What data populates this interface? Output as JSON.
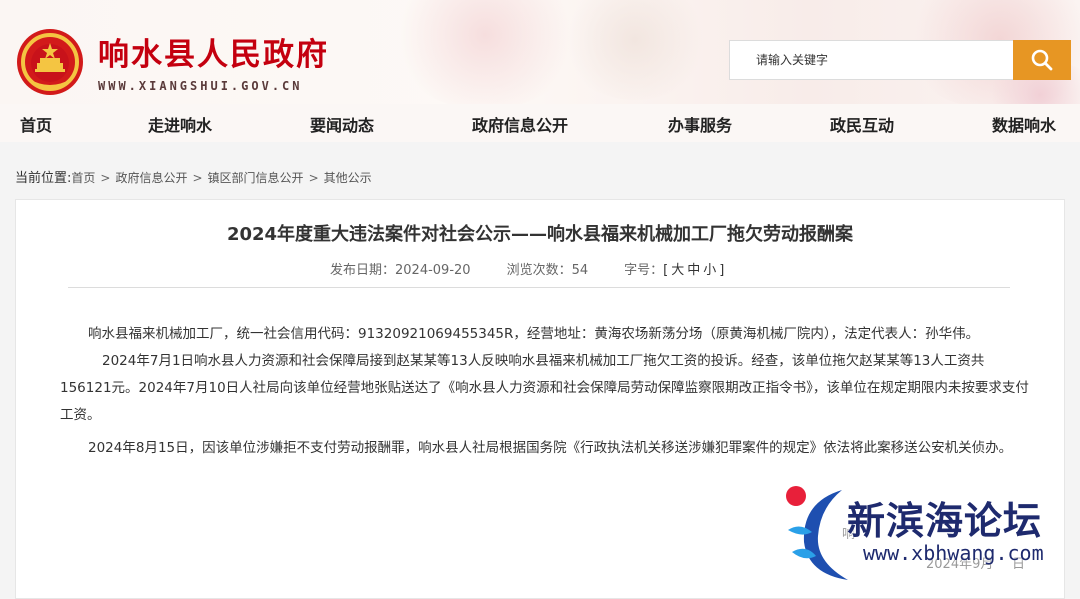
{
  "header": {
    "site_title": "响水县人民政府",
    "site_domain": "WWW.XIANGSHUI.GOV.CN",
    "search_placeholder": "请输入关键字"
  },
  "nav": {
    "items": [
      {
        "label": "首页"
      },
      {
        "label": "走进响水"
      },
      {
        "label": "要闻动态"
      },
      {
        "label": "政府信息公开"
      },
      {
        "label": "办事服务"
      },
      {
        "label": "政民互动"
      },
      {
        "label": "数据响水"
      }
    ]
  },
  "breadcrumb": {
    "lead": "当前位置:",
    "items": [
      "首页",
      "政府信息公开",
      "镇区部门信息公开",
      "其他公示"
    ],
    "separator": ">"
  },
  "article": {
    "title": "2024年度重大违法案件对社会公示——响水县福来机械加工厂拖欠劳动报酬案",
    "date_label": "发布日期：",
    "date": "2024-09-20",
    "views_label": "浏览次数：",
    "views": "54",
    "font_label": "字号：",
    "font_open": "[",
    "font_sizes": [
      "大",
      "中",
      "小"
    ],
    "font_close": "]",
    "paragraphs": [
      "响水县福来机械加工厂，统一社会信用代码：91320921069455345R，经营地址：黄海农场新荡分场（原黄海机械厂院内），法定代表人：孙华伟。",
      "2024年7月1日响水县人力资源和社会保障局接到赵某某等13人反映响水县福来机械加工厂拖欠工资的投诉。经查，该单位拖欠赵某某等13人工资共156121元。2024年7月10日人社局向该单位经营地张贴送达了《响水县人力资源和社会保障局劳动保障监察限期改正指令书》，该单位在规定期限内未按要求支付工资。",
      "2024年8月15日，因该单位涉嫌拒不支付劳动报酬罪，响水县人社局根据国务院《行政执法机关移送涉嫌犯罪案件的规定》依法将此案移送公安机关侦办。"
    ],
    "signature_left": "响",
    "signature_right": "2024年9月",
    "signature_end": "日"
  },
  "watermark": {
    "name": "新滨海论坛",
    "url": "www.xbhwang.com"
  },
  "colors": {
    "brand_red": "#c4000f",
    "search_orange": "#e79623",
    "watermark_blue": "#1e2a6e",
    "watermark_red": "#e8203a"
  }
}
